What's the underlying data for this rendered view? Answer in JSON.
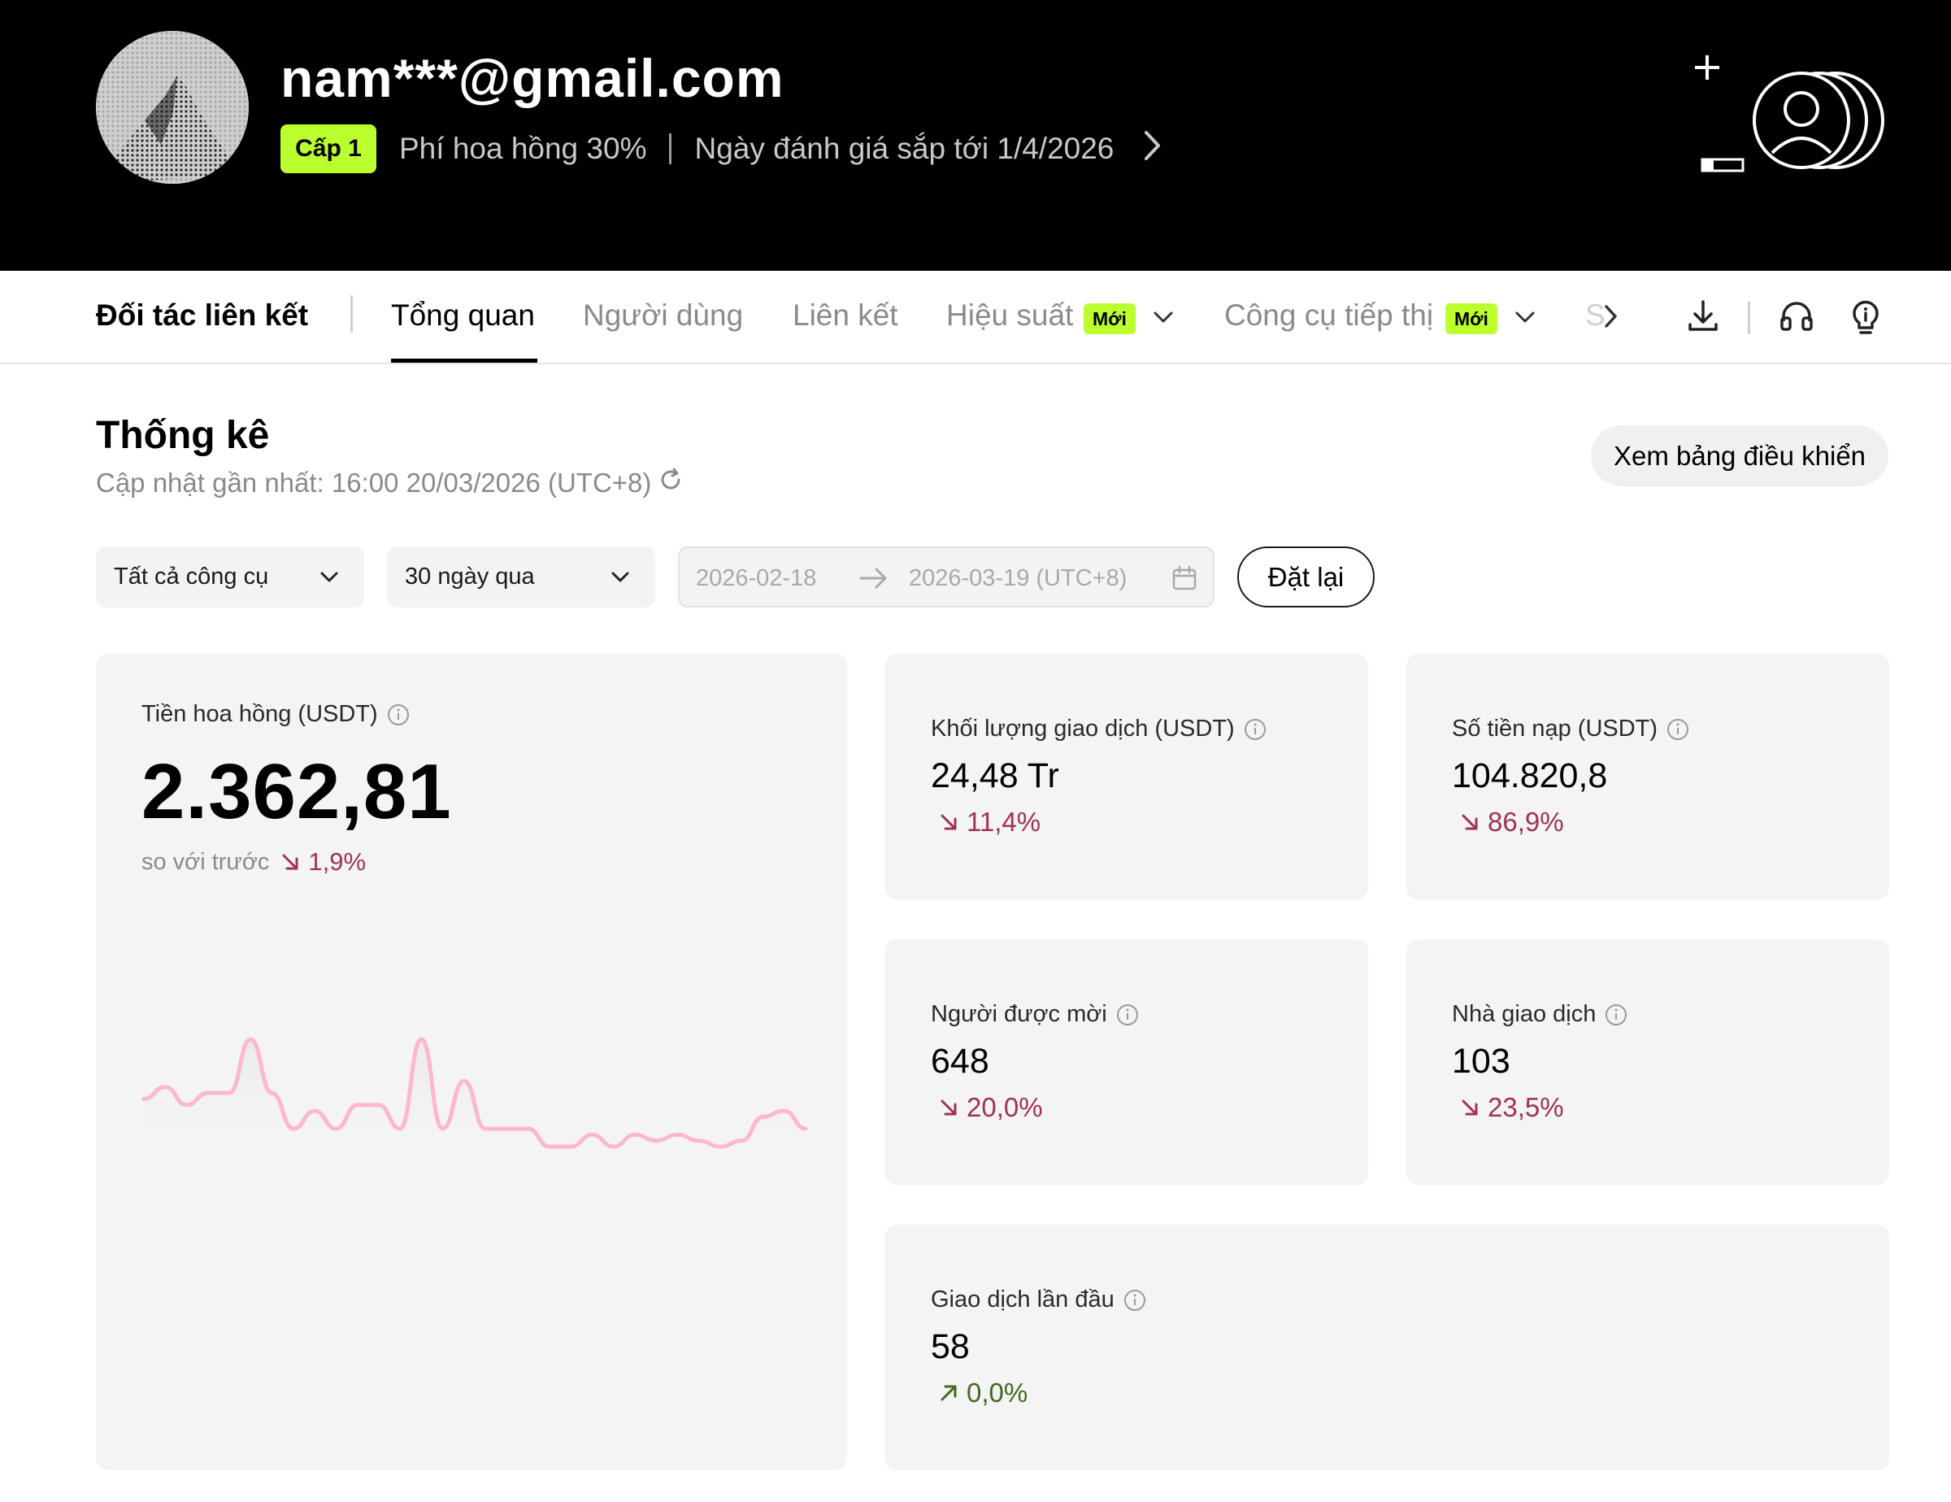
{
  "profile": {
    "email": "nam***@gmail.com",
    "level": "Cấp 1",
    "commission_rate": "Phí hoa hồng 30%",
    "next_review": "Ngày đánh giá sắp tới 1/4/2026"
  },
  "nav": {
    "brand": "Đối tác liên kết",
    "tabs": [
      {
        "label": "Tổng quan",
        "active": true
      },
      {
        "label": "Người dùng"
      },
      {
        "label": "Liên kết"
      },
      {
        "label": "Hiệu suất",
        "badge": "Mới"
      },
      {
        "label": "Công cụ tiếp thị",
        "badge": "Mới"
      },
      {
        "label": "S"
      }
    ],
    "icons": [
      "chevron-right-icon",
      "download-icon",
      "headset-icon",
      "lightbulb-icon"
    ]
  },
  "stats": {
    "title": "Thống kê",
    "updated": "Cập nhật gần nhất: 16:00 20/03/2026 (UTC+8)",
    "dashboard_button": "Xem bảng điều khiển"
  },
  "filters": {
    "tool": "Tất cả công cụ",
    "period": "30 ngày qua",
    "date_from": "2026-02-18",
    "date_to": "2026-03-19 (UTC+8)",
    "reset": "Đặt lại"
  },
  "cards": {
    "commission": {
      "label": "Tiền hoa hồng (USDT)",
      "value": "2.362,81",
      "compare_label": "so với trước",
      "change": "1,9%",
      "direction": "down"
    },
    "volume": {
      "label": "Khối lượng giao dịch (USDT)",
      "value": "24,48 Tr",
      "change": "11,4%",
      "direction": "down"
    },
    "deposit": {
      "label": "Số tiền nạp (USDT)",
      "value": "104.820,8",
      "change": "86,9%",
      "direction": "down"
    },
    "invitees": {
      "label": "Người được mời",
      "value": "648",
      "change": "20,0%",
      "direction": "down"
    },
    "traders": {
      "label": "Nhà giao dịch",
      "value": "103",
      "change": "23,5%",
      "direction": "down"
    },
    "first_trade": {
      "label": "Giao dịch lần đầu",
      "value": "58",
      "change": "0,0%",
      "direction": "up"
    }
  },
  "colors": {
    "accent": "#bcff2f",
    "down": "#a0315a",
    "up": "#3f6a1f",
    "sparkline": "#ffb6cf"
  },
  "chart_data": {
    "type": "line",
    "values": [
      2,
      4,
      1,
      3,
      3,
      12,
      3,
      -3,
      0,
      -3,
      1,
      1,
      -3,
      12,
      -3,
      5,
      -3,
      -3,
      -3,
      -6,
      -6,
      -4,
      -6,
      -4,
      -5,
      -4,
      -5,
      -6,
      -5,
      -1,
      0,
      -3
    ],
    "xlabel": "",
    "ylabel": ""
  }
}
